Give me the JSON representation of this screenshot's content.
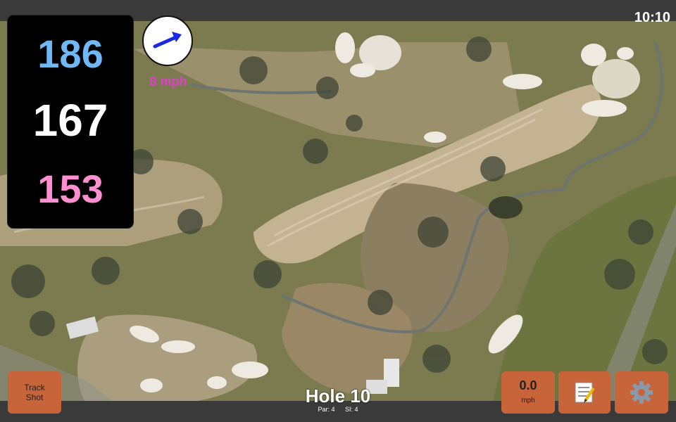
{
  "status": {
    "clock": "10:10"
  },
  "yardage": {
    "back": "186",
    "middle": "167",
    "front": "153"
  },
  "wind": {
    "speed_label": "8 mph",
    "direction_icon": "wind-arrow-icon"
  },
  "buttons": {
    "track_shot_line1": "Track",
    "track_shot_line2": "Shot",
    "speed_value": "0.0",
    "speed_unit": "mph",
    "notes_icon": "notepad-icon",
    "settings_icon": "gear-icon"
  },
  "hole": {
    "title": "Hole 10",
    "par": "Par: 4",
    "si": "SI: 4"
  },
  "colors": {
    "back": "#6fb7f5",
    "middle": "#ffffff",
    "front": "#ff8fd0",
    "wind_text": "#e040c8",
    "button": "#c8643a"
  }
}
